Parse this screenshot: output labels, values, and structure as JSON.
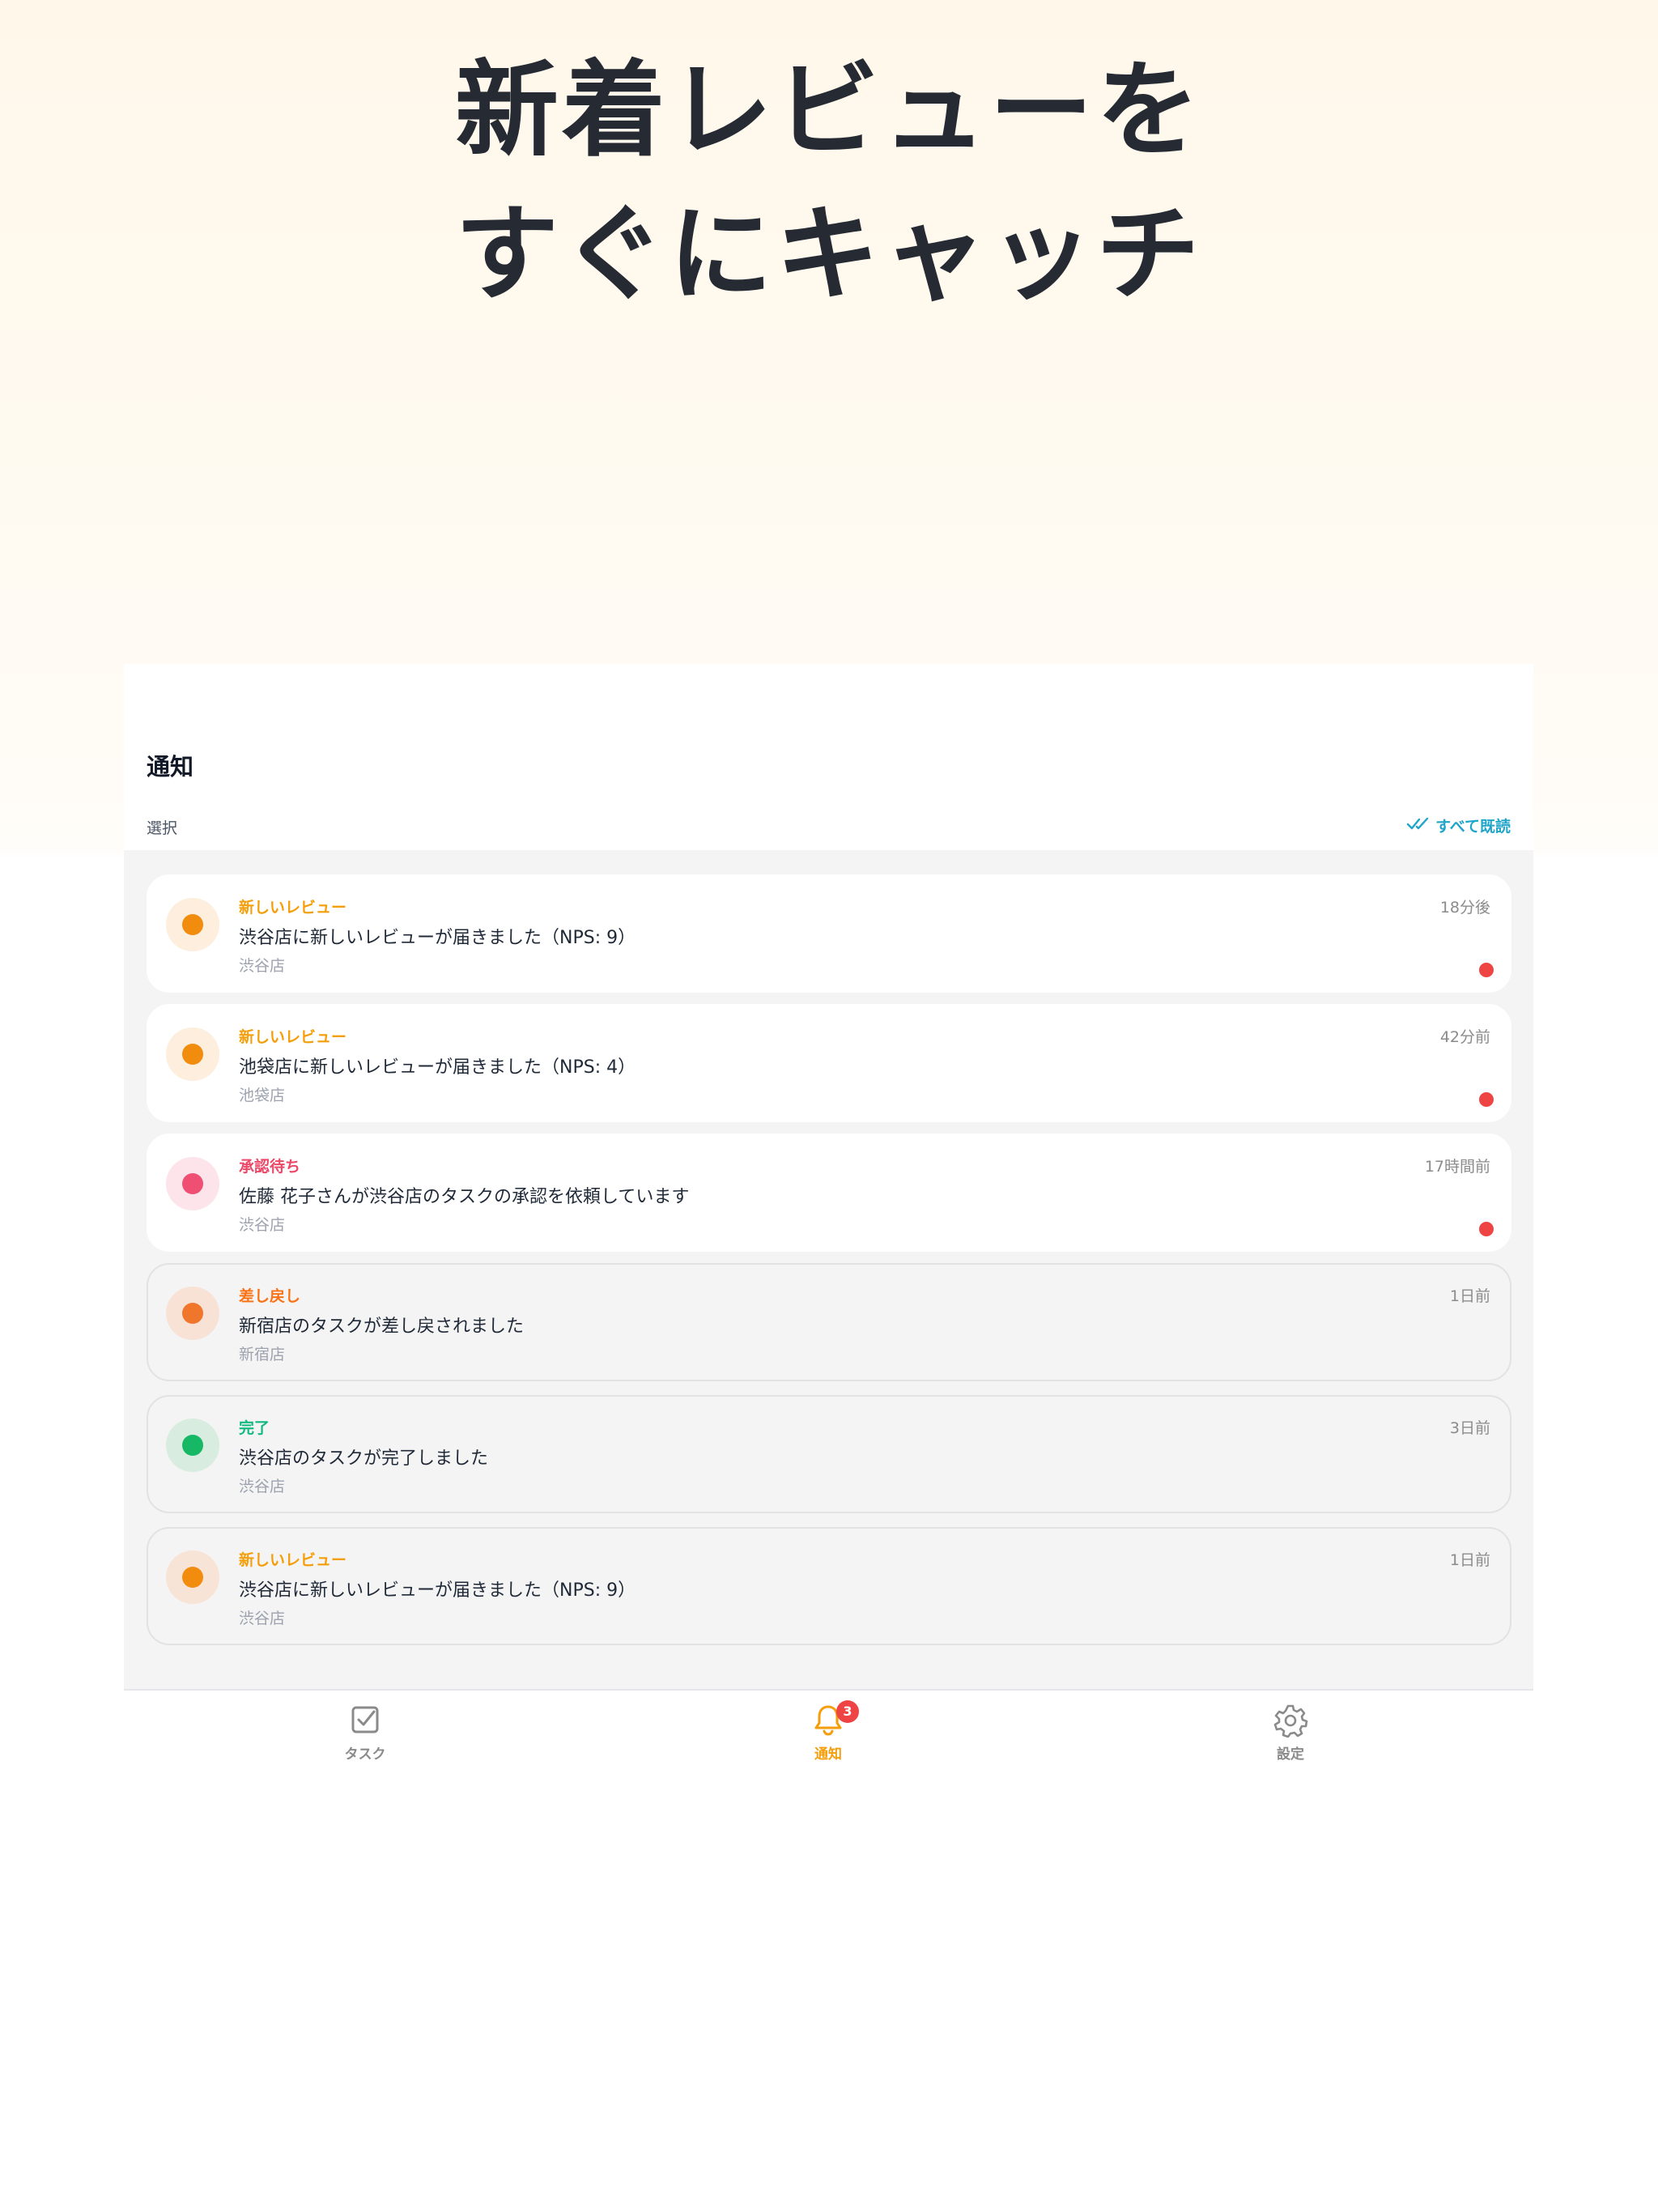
{
  "headline": {
    "line1": "新着レビューを",
    "line2": "すぐにキャッチ"
  },
  "header": {
    "title": "通知",
    "select_label": "選択",
    "mark_all_read_label": "すべて既読"
  },
  "notifications": [
    {
      "type_label": "新しいレビュー",
      "message": "渋谷店に新しいレビューが届きました（NPS: 9）",
      "store": "渋谷店",
      "time": "18分後",
      "unread": true,
      "accent_color": "#f59e0b",
      "dot_color": "#f28c0f",
      "icon_bg": "#fdeedd"
    },
    {
      "type_label": "新しいレビュー",
      "message": "池袋店に新しいレビューが届きました（NPS: 4）",
      "store": "池袋店",
      "time": "42分前",
      "unread": true,
      "accent_color": "#f59e0b",
      "dot_color": "#f28c0f",
      "icon_bg": "#fdeedd"
    },
    {
      "type_label": "承認待ち",
      "message": "佐藤 花子さんが渋谷店のタスクの承認を依頼しています",
      "store": "渋谷店",
      "time": "17時間前",
      "unread": true,
      "accent_color": "#ec4868",
      "dot_color": "#ef4f72",
      "icon_bg": "#fde4ea"
    },
    {
      "type_label": "差し戻し",
      "message": "新宿店のタスクが差し戻されました",
      "store": "新宿店",
      "time": "1日前",
      "unread": false,
      "accent_color": "#f97316",
      "dot_color": "#f0762c",
      "icon_bg": "#f8e2d6"
    },
    {
      "type_label": "完了",
      "message": "渋谷店のタスクが完了しました",
      "store": "渋谷店",
      "time": "3日前",
      "unread": false,
      "accent_color": "#10b981",
      "dot_color": "#16b866",
      "icon_bg": "#d8ecdf"
    },
    {
      "type_label": "新しいレビュー",
      "message": "渋谷店に新しいレビューが届きました（NPS: 9）",
      "store": "渋谷店",
      "time": "1日前",
      "unread": false,
      "accent_color": "#f59e0b",
      "dot_color": "#f28c0f",
      "icon_bg": "#f8e4d6"
    }
  ],
  "tabbar": {
    "tabs": [
      {
        "label": "タスク",
        "icon": "checkbox-icon",
        "active": false
      },
      {
        "label": "通知",
        "icon": "bell-icon",
        "active": true,
        "badge": "3"
      },
      {
        "label": "設定",
        "icon": "gear-icon",
        "active": false
      }
    ],
    "active_color": "#f59e0b",
    "inactive_color": "#8a8a8a"
  }
}
